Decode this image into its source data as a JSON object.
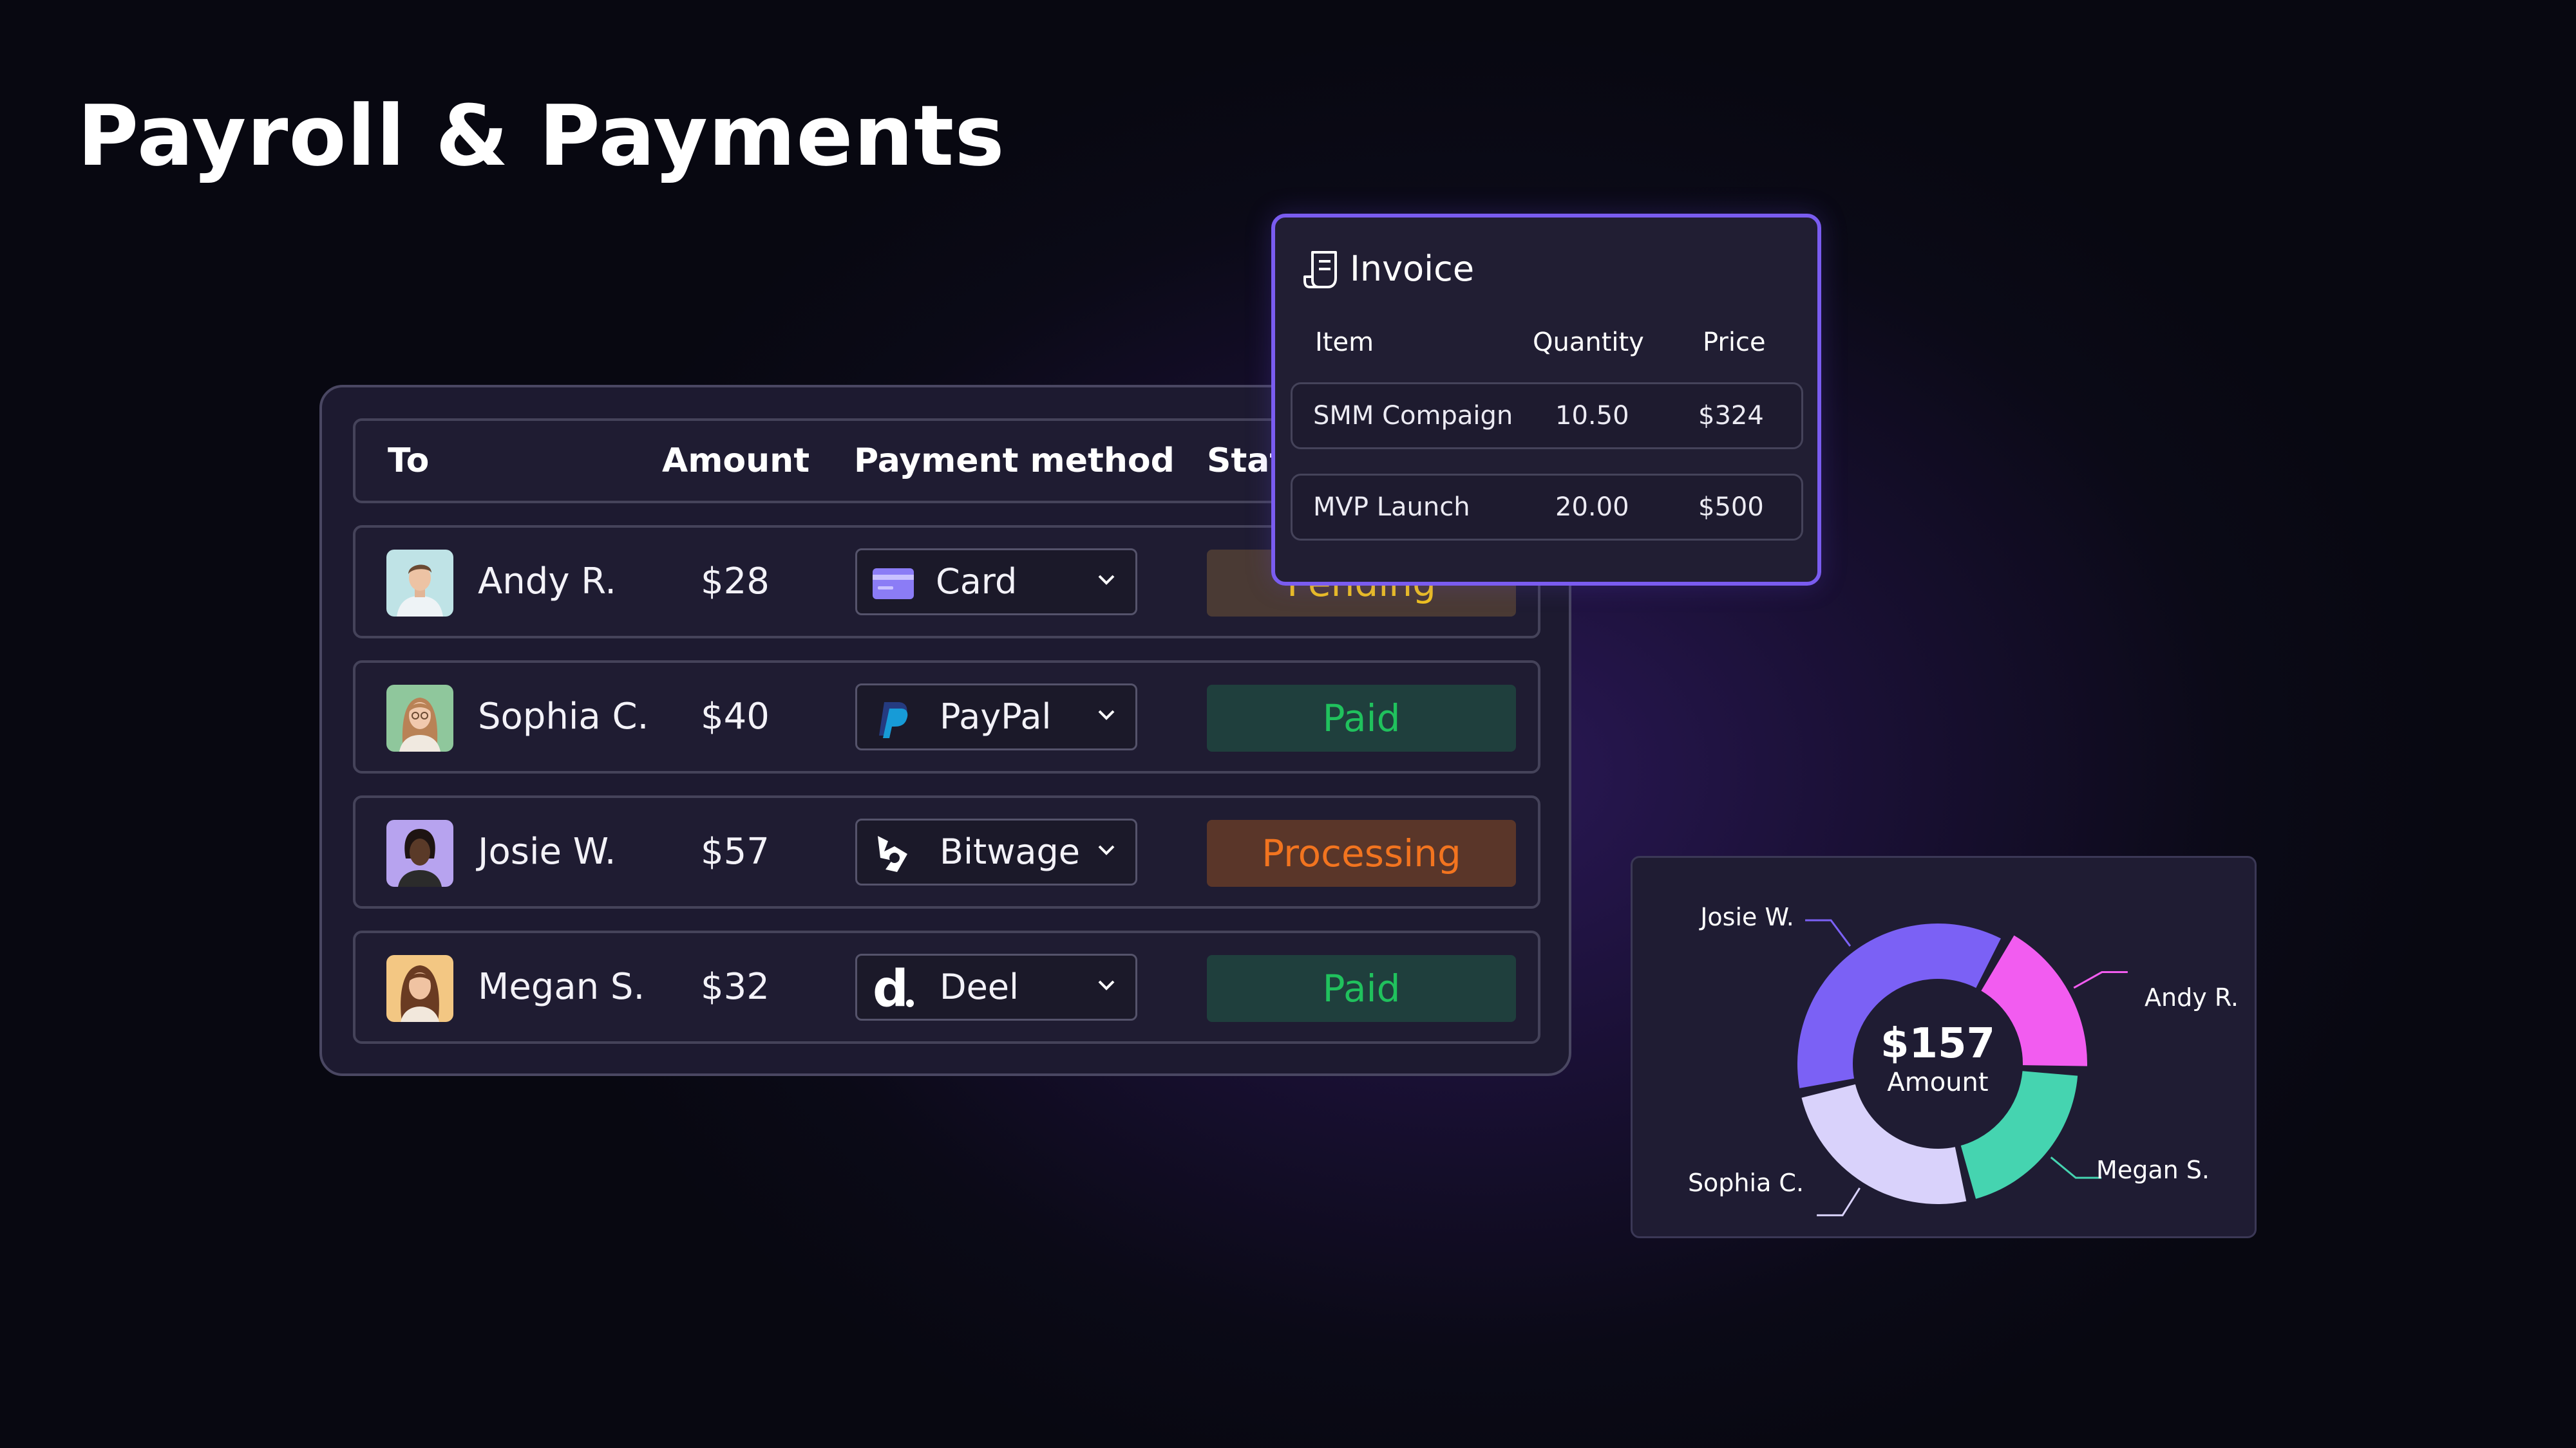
{
  "page": {
    "title": "Payroll & Payments"
  },
  "table": {
    "headers": {
      "to": "To",
      "amount": "Amount",
      "method": "Payment method",
      "status": "Stat"
    },
    "rows": [
      {
        "name": "Andy R.",
        "amount": "$28",
        "method": "Card",
        "method_icon": "card-icon",
        "status": "Pending",
        "status_color": "#f0c21e"
      },
      {
        "name": "Sophia C.",
        "amount": "$40",
        "method": "PayPal",
        "method_icon": "paypal-icon",
        "status": "Paid",
        "status_color": "#20c15d"
      },
      {
        "name": "Josie W.",
        "amount": "$57",
        "method": "Bitwage",
        "method_icon": "bitwage-icon",
        "status": "Processing",
        "status_color": "#f2741f"
      },
      {
        "name": "Megan S.",
        "amount": "$32",
        "method": "Deel",
        "method_icon": "deel-icon",
        "status": "Paid",
        "status_color": "#20c15d"
      }
    ]
  },
  "invoice": {
    "title": "Invoice",
    "icon": "receipt-icon",
    "headers": {
      "item": "Item",
      "quantity": "Quantity",
      "price": "Price"
    },
    "rows": [
      {
        "item": "SMM Compaign",
        "quantity": "10.50",
        "price": "$324"
      },
      {
        "item": "MVP Launch",
        "quantity": "20.00",
        "price": "$500"
      }
    ]
  },
  "chart_data": {
    "type": "pie",
    "total_label": "$157",
    "center_caption": "Amount",
    "slices": [
      {
        "name": "Josie W.",
        "value": 57,
        "color": "#7b61f5"
      },
      {
        "name": "Andy R.",
        "value": 28,
        "color": "#f25cf0"
      },
      {
        "name": "Megan S.",
        "value": 32,
        "color": "#45d4b0"
      },
      {
        "name": "Sophia C.",
        "value": 40,
        "color": "#d9d2fb"
      }
    ]
  },
  "colors": {
    "accent": "#7a5cf0",
    "pending": "#f0c21e",
    "paid": "#20c15d",
    "processing": "#f2741f"
  }
}
